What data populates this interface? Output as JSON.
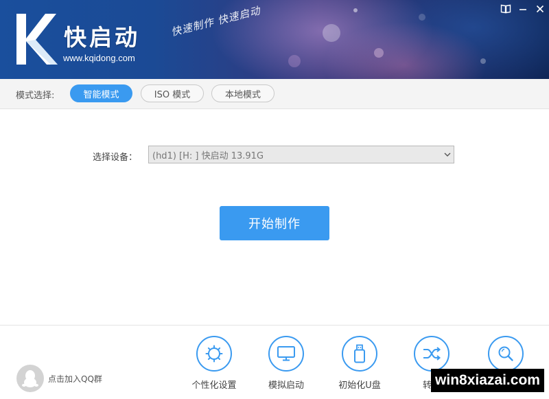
{
  "header": {
    "app_title": "快启动",
    "app_url": "www.kqidong.com",
    "slogan": "快速制作 快速启动",
    "logo_letter": "K"
  },
  "window_controls": {
    "help_icon": "book-icon",
    "minimize_icon": "minimize-icon",
    "close_icon": "close-icon"
  },
  "mode_bar": {
    "label": "模式选择:",
    "tabs": [
      {
        "label": "智能模式",
        "active": true
      },
      {
        "label": "ISO 模式",
        "active": false
      },
      {
        "label": "本地模式",
        "active": false
      }
    ]
  },
  "main": {
    "device_label": "选择设备：",
    "device_value": "(hd1) [H: ] 快启动 13.91G",
    "start_button": "开始制作"
  },
  "bottom": {
    "qq_label": "点击加入QQ群",
    "tools": [
      {
        "label": "个性化设置",
        "icon": "gear-icon"
      },
      {
        "label": "模拟启动",
        "icon": "monitor-icon"
      },
      {
        "label": "初始化U盘",
        "icon": "usb-drive-icon"
      },
      {
        "label": "转换",
        "icon": "shuffle-icon"
      },
      {
        "label": "",
        "icon": "search-icon"
      }
    ]
  },
  "watermark": "win8xiazai.com",
  "colors": {
    "accent": "#3a9af0",
    "header_blue": "#1a4f9d"
  }
}
